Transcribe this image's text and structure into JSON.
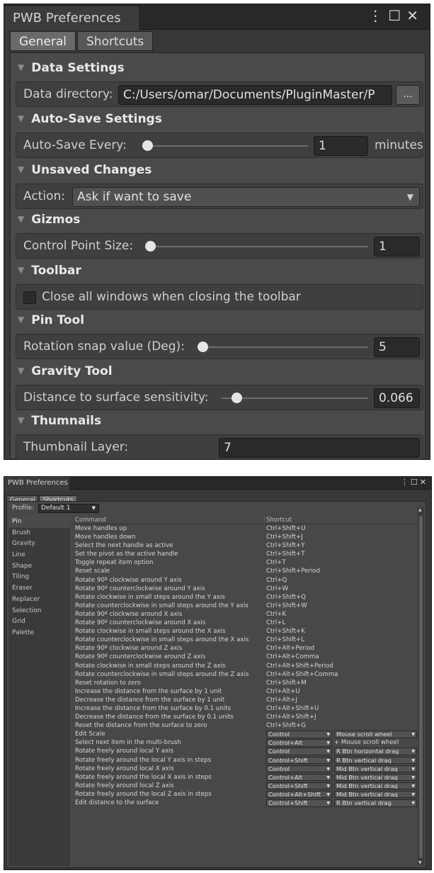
{
  "window1": {
    "title": "PWB Preferences",
    "tabs": [
      "General",
      "Shortcuts"
    ],
    "sections": {
      "data": {
        "title": "Data Settings",
        "label": "Data directory:",
        "value": "C:/Users/omar/Documents/PluginMaster/P",
        "browse": "..."
      },
      "autosave": {
        "title": "Auto-Save Settings",
        "label": "Auto-Save Every:",
        "value": "1",
        "unit": "minutes"
      },
      "unsaved": {
        "title": "Unsaved Changes",
        "label": "Action:",
        "value": "Ask if want to save"
      },
      "gizmos": {
        "title": "Gizmos",
        "label": "Control Point Size:",
        "value": "1"
      },
      "toolbar": {
        "title": "Toolbar",
        "label": "Close all windows when closing the toolbar"
      },
      "pin": {
        "title": "Pin Tool",
        "label": "Rotation snap value (Deg):",
        "value": "5"
      },
      "gravity": {
        "title": "Gravity Tool",
        "label": "Distance to surface sensitivity:",
        "value": "0.066"
      },
      "thumbnails": {
        "title": "Thumnails",
        "label": "Thumbnail Layer:",
        "value": "7"
      }
    }
  },
  "window2": {
    "title": "PWB Preferences",
    "tabs": [
      "General",
      "Shortcuts"
    ],
    "profile_label": "Profile:",
    "profile_value": "Default 1",
    "categories": [
      "Pin",
      "Brush",
      "Gravity",
      "Line",
      "Shape",
      "Tiling",
      "Eraser",
      "Replacer",
      "Selection",
      "Grid",
      "Palette"
    ],
    "header": {
      "command": "Command",
      "shortcut": "Shortcut"
    },
    "rows": [
      {
        "cmd": "Move handles up",
        "sc": "Ctrl+Shift+U"
      },
      {
        "cmd": "Move handles down",
        "sc": "Ctrl+Shift+J"
      },
      {
        "cmd": "Select the next handle as active",
        "sc": "Ctrl+Shift+Y"
      },
      {
        "cmd": "Set the pivot as the active handle",
        "sc": "Ctrl+Shift+T"
      },
      {
        "cmd": "Toggle repeat item option",
        "sc": "Ctrl+T"
      },
      {
        "cmd": "Reset scale",
        "sc": "Ctrl+Shift+Period"
      },
      {
        "cmd": "Rotate 90º clockwise around Y axis",
        "sc": "Ctrl+Q"
      },
      {
        "cmd": "Rotate 90º counterclockwise around Y axis",
        "sc": "Ctrl+W"
      },
      {
        "cmd": "Rotate clockwise in small steps around the Y axis",
        "sc": "Ctrl+Shift+Q"
      },
      {
        "cmd": "Rotate counterclockwise in small steps around the Y axis",
        "sc": "Ctrl+Shift+W"
      },
      {
        "cmd": "Rotate 90º clockwise around X axis",
        "sc": "Ctrl+K"
      },
      {
        "cmd": "Rotate 90º counterclockwise around X axis",
        "sc": "Ctrl+L"
      },
      {
        "cmd": "Rotate clockwise in small steps around the X axis",
        "sc": "Ctrl+Shift+K"
      },
      {
        "cmd": "Rotate counterclockwise in small steps around the X axis",
        "sc": "Ctrl+Shift+L"
      },
      {
        "cmd": "Rotate 90º clockwise around Z axis",
        "sc": "Ctrl+Alt+Period"
      },
      {
        "cmd": "Rotate 90º counterclockwise around Z axis",
        "sc": "Ctrl+Alt+Comma"
      },
      {
        "cmd": "Rotate clockwise in small steps around the Z axis",
        "sc": "Ctrl+Alt+Shift+Period"
      },
      {
        "cmd": "Rotate counterclockwise in small steps around the Z axis",
        "sc": "Ctrl+Alt+Shift+Comma"
      },
      {
        "cmd": "Reset rotation to zero",
        "sc": "Ctrl+Shift+M"
      },
      {
        "cmd": "Increase the distance from the surface by 1 unit",
        "sc": "Ctrl+Alt+U"
      },
      {
        "cmd": "Decrease the distance from the surface by 1 unit",
        "sc": "Ctrl+Alt+J"
      },
      {
        "cmd": "Increase the distance from the surface by 0.1 units",
        "sc": "Ctrl+Alt+Shift+U"
      },
      {
        "cmd": "Decrease the distance from the surface by 0.1 units",
        "sc": "Ctrl+Alt+Shift+J"
      },
      {
        "cmd": "Reset the distance from the surface to zero",
        "sc": "Ctrl+Shift+G"
      }
    ],
    "mouse_rows": [
      {
        "cmd": "Edit Scale",
        "mod": "Control",
        "act": "Mouse scroll wheel"
      },
      {
        "cmd": "Select next item in the multi-brush",
        "mod": "Control+Alt",
        "plus": "+ Mouse scroll wheel"
      },
      {
        "cmd": "Rotate freely around local Y axis",
        "mod": "Control",
        "act": "R Btn horizontal drag"
      },
      {
        "cmd": "Rotate freely around the local Y axis in steps",
        "mod": "Control+Shift",
        "act": "R Btn vertical drag"
      },
      {
        "cmd": "Rotate freely around local X axis",
        "mod": "Control",
        "act": "Mid Btn vertical drag"
      },
      {
        "cmd": "Rotate freely around the local X axis in steps",
        "mod": "Control+Alt",
        "act": "Mid Btn vertical drag"
      },
      {
        "cmd": "Rotate freely around local Z axis",
        "mod": "Control+Shift",
        "act": "Mid Btn vertical drag"
      },
      {
        "cmd": "Rotate freely around the local Z axis in steps",
        "mod": "Control+Alt+Shift",
        "act": "Mid Btn vertical drag"
      },
      {
        "cmd": "Edit distance to the surface",
        "mod": "Control+Shift",
        "act": "R Btn vertical drag"
      }
    ]
  }
}
